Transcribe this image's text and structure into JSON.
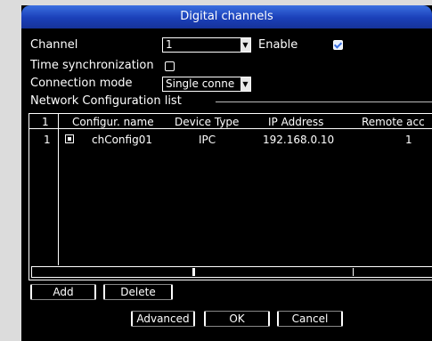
{
  "dialog": {
    "title": "Digital channels"
  },
  "form": {
    "channel_label": "Channel",
    "channel_value": "1",
    "enable_label": "Enable",
    "enable_checked": true,
    "time_sync_label": "Time synchronization",
    "time_sync_checked": false,
    "connection_mode_label": "Connection mode",
    "connection_mode_value": "Single conne"
  },
  "network_list": {
    "section_label": "Network Configuration list",
    "columns": [
      "1",
      "Configur. name",
      "Device Type",
      "IP Address",
      "Remote acc"
    ],
    "rows": [
      {
        "index": "1",
        "checked": true,
        "config_name": "chConfig01",
        "device_type": "IPC",
        "ip_address": "192.168.0.10",
        "remote": "1"
      }
    ]
  },
  "buttons": {
    "add": "Add",
    "delete": "Delete",
    "advanced": "Advanced",
    "ok": "OK",
    "cancel": "Cancel"
  }
}
